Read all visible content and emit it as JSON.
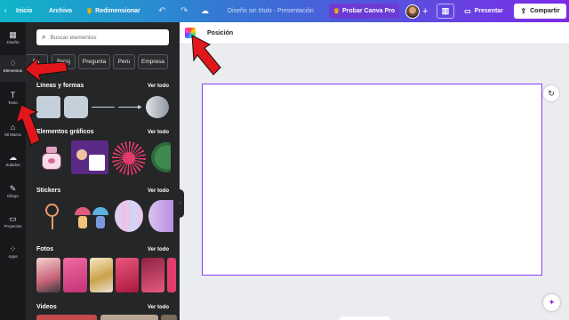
{
  "topbar": {
    "home": "Inicio",
    "file": "Archivo",
    "resize": "Redimensionar",
    "undo_icon": "undo-icon",
    "redo_icon": "redo-icon",
    "cloud_icon": "cloud-sync-icon",
    "doc_title": "Diseño sin título - Presentación",
    "try_pro": "Probar Canva Pro",
    "plus_icon": "plus-icon",
    "stats_icon": "bar-chart-icon",
    "present": "Presentar",
    "share": "Compartir",
    "colors": {
      "gradient_start": "#0fb5c9",
      "gradient_end": "#7d2ae8",
      "pro_button": "#6c3bd6",
      "crown": "#f5b400"
    }
  },
  "sidebar": {
    "items": [
      {
        "label": "Diseño",
        "icon": "layout-icon"
      },
      {
        "label": "Elementos",
        "icon": "shapes-icon",
        "active": true
      },
      {
        "label": "Texto",
        "icon": "text-icon"
      },
      {
        "label": "Mi Marca",
        "icon": "brand-icon"
      },
      {
        "label": "Subidos",
        "icon": "upload-cloud-icon"
      },
      {
        "label": "Dibujo",
        "icon": "draw-icon"
      },
      {
        "label": "Proyectos",
        "icon": "folder-icon"
      },
      {
        "label": "Apps",
        "icon": "apps-grid-icon"
      }
    ]
  },
  "panel": {
    "search_placeholder": "Buscar elementos",
    "chips": [
      "Sa",
      "Reloj",
      "Pregunta",
      "Peru",
      "Empresa"
    ],
    "sections": [
      {
        "title": "Líneas y formas",
        "see_all": "Ver todo"
      },
      {
        "title": "Elementos gráficos",
        "see_all": "Ver todo"
      },
      {
        "title": "Stickers",
        "see_all": "Ver todo"
      },
      {
        "title": "Fotos",
        "see_all": "Ver todo"
      },
      {
        "title": "Videos",
        "see_all": "Ver todo"
      }
    ]
  },
  "canvas": {
    "toolbar_label": "Posición",
    "accent": "#8b3dff"
  }
}
